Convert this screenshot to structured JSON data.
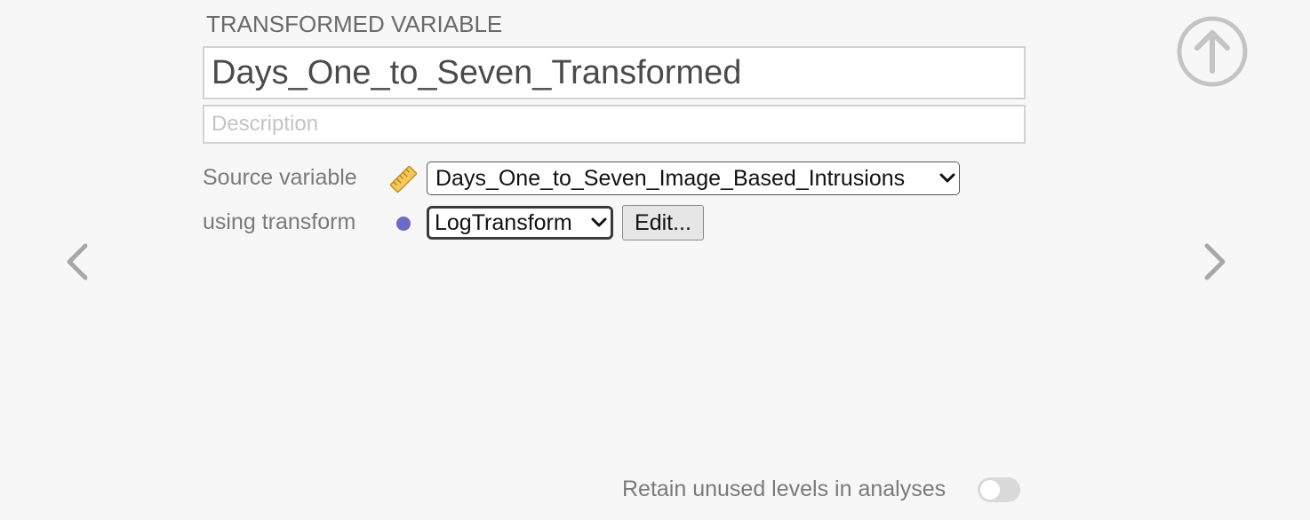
{
  "section": {
    "title": "TRANSFORMED VARIABLE"
  },
  "variable": {
    "name": "Days_One_to_Seven_Transformed",
    "description_placeholder": "Description",
    "description_value": ""
  },
  "source": {
    "label": "Source variable",
    "icon": "ruler-icon",
    "selected": "Days_One_to_Seven_Image_Based_Intrusions"
  },
  "transform": {
    "label": "using transform",
    "icon": "dot-icon",
    "selected": "LogTransform",
    "edit_label": "Edit..."
  },
  "footer": {
    "retain_label": "Retain unused levels in analyses",
    "retain_on": false
  },
  "colors": {
    "background": "#f7f7f7",
    "label": "#7a7a7a",
    "dot": "#6c6bc8",
    "ruler": "#e8b84a",
    "nav": "#a8a8a8"
  }
}
